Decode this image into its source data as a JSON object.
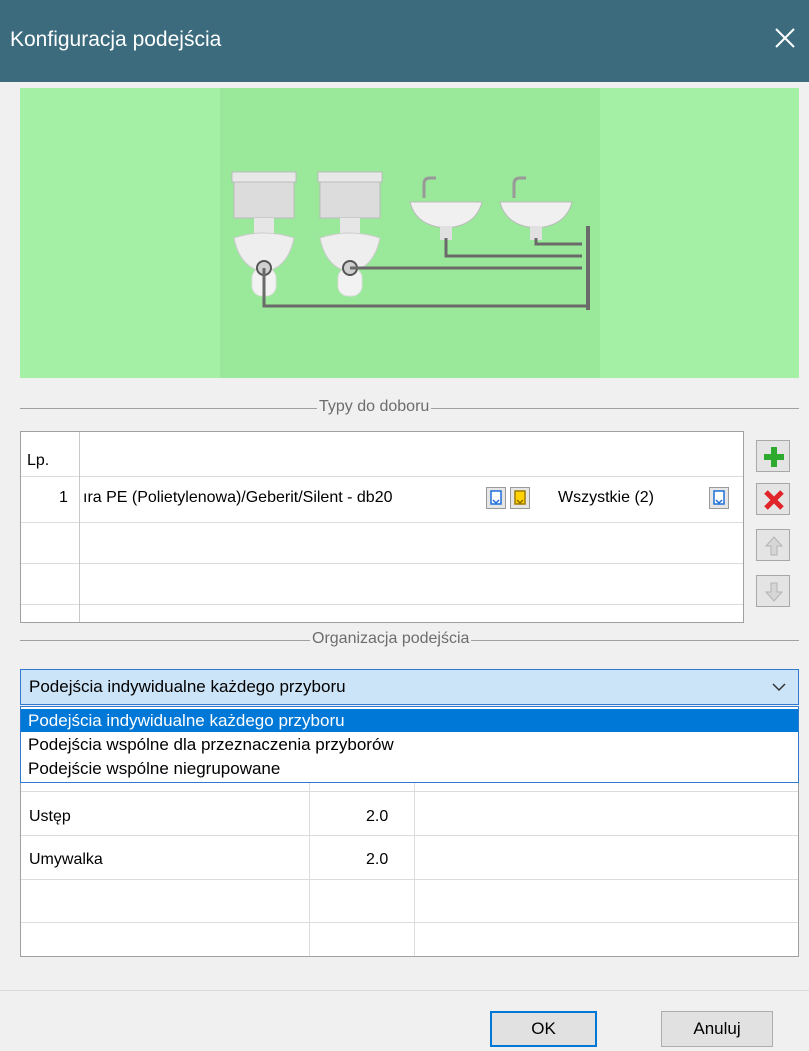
{
  "window": {
    "title": "Konfiguracja podejścia",
    "close_icon": "close-icon"
  },
  "sections": {
    "types_label": "Typy do doboru",
    "organization_label": "Organizacja podejścia"
  },
  "types_table": {
    "header": "Lp.",
    "rows": [
      {
        "index": "1",
        "pipe": "ıra PE (Polietylenowa)/Geberit/Silent - db20",
        "scope": "Wszystkie (2)"
      }
    ]
  },
  "side_buttons": [
    "add-icon",
    "delete-icon",
    "move-up-icon",
    "move-down-icon"
  ],
  "organization": {
    "selected": "Podejścia indywidualne każdego przyboru",
    "options": [
      "Podejścia indywidualne każdego przyboru",
      "Podejścia wspólne dla przeznaczenia przyborów",
      "Podejście wspólne niegrupowane"
    ]
  },
  "fixtures_table": {
    "rows": [
      {
        "name": "Ustęp",
        "value": "2.0"
      },
      {
        "name": "Umywalka",
        "value": "2.0"
      }
    ]
  },
  "footer": {
    "ok_label": "OK",
    "cancel_label": "Anuluj"
  },
  "colors": {
    "titlebar": "#3b6b7d",
    "preview_bg": "#a4f0a4",
    "selection": "#0078d7",
    "add": "#2eaa2e",
    "delete": "#e0242a"
  }
}
